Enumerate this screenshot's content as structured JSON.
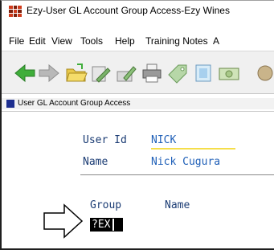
{
  "window": {
    "title": "Ezy-User GL Account Group Access-Ezy Wines"
  },
  "menu": [
    "File",
    "Edit",
    "View",
    "Tools",
    "Help",
    "Training Notes",
    "A"
  ],
  "toolbar": {
    "buttons": [
      "back-arrow-icon",
      "forward-arrow-icon",
      "open-folder-icon",
      "edit-document-icon",
      "edit-pencil-icon",
      "printer-icon",
      "tag-icon",
      "page-icon",
      "money-icon"
    ]
  },
  "section": {
    "title": "User GL Account Group Access"
  },
  "form": {
    "user_id_label": "User Id",
    "user_id_value": "NICK",
    "name_label": "Name",
    "name_value": "Nick Cugura"
  },
  "grid": {
    "col_group": "Group",
    "col_name": "Name",
    "input_value": "?EX"
  },
  "colors": {
    "label": "#1b3c74",
    "value": "#2060b8",
    "highlight": "#f5de4a",
    "section_square": "#1d2e8f"
  }
}
